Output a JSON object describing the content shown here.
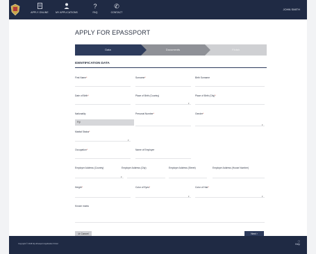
{
  "topnav": {
    "items": [
      {
        "label": "APPLY ONLINE",
        "icon": "doc-icon"
      },
      {
        "label": "MY APPLICATIONS",
        "icon": "user-icon"
      },
      {
        "label": "FAQ",
        "icon": "question-icon"
      },
      {
        "label": "CONTACT",
        "icon": "phone-icon"
      }
    ],
    "user": "JOHN SMITH"
  },
  "page": {
    "title": "APPLY FOR EPASSPORT",
    "steps": [
      "Data",
      "Documents",
      "Finish"
    ],
    "section": "IDENTIFICATION DATA"
  },
  "fields": {
    "first_name": "First Name",
    "surname": "Surname",
    "birth_surname": "Birth Surname",
    "date_of_birth": "Date of Birth",
    "place_birth_country": "Place of Birth (Country)",
    "place_birth_city": "Place of Birth (City)",
    "nationality": "Nationality",
    "nationality_value": "Fiji",
    "personal_number": "Personal Number",
    "gender": "Gender",
    "marital_status": "Marital Status",
    "occupation": "Occupation",
    "name_employer": "Name of Employer",
    "employer_country": "Employer Address (Country)",
    "employer_city": "Employer Address (City)",
    "employer_street": "Employer Address (Street)",
    "employer_house": "Employer Address (House Number)",
    "height": "Height",
    "color_eyes": "Color of Eyes",
    "color_hair": "Color of Hair",
    "known_marks": "Known marks"
  },
  "buttons": {
    "cancel": "Cancel",
    "next": "Next"
  },
  "footer": {
    "copyright": "Copyright © 2018 Fiji ePassport Application Portal",
    "help": "Help"
  },
  "colors": {
    "navy": "#1f2a44",
    "accent": "#2d3b5c"
  }
}
